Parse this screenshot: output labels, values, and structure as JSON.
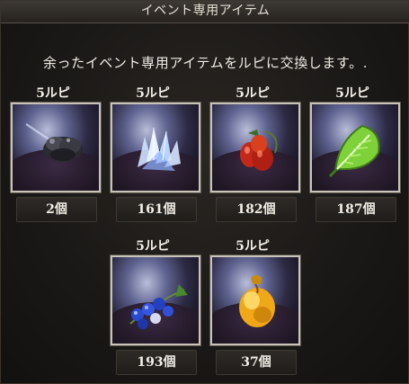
{
  "dialog": {
    "title": "イベント専用アイテム",
    "message": "余ったイベント専用アイテムをルピに交換します。."
  },
  "items": [
    {
      "price": "5ルピ",
      "count": "2個",
      "icon": "rock-icon"
    },
    {
      "price": "5ルピ",
      "count": "161個",
      "icon": "crystal-icon"
    },
    {
      "price": "5ルピ",
      "count": "182個",
      "icon": "berry-icon"
    },
    {
      "price": "5ルピ",
      "count": "187個",
      "icon": "leaf-icon"
    },
    {
      "price": "5ルピ",
      "count": "193個",
      "icon": "blueberry-icon"
    },
    {
      "price": "5ルピ",
      "count": "37個",
      "icon": "pouch-icon"
    }
  ],
  "colors": {
    "panel_bg": "#1b1917",
    "text": "#f0ece4",
    "frame_border": "#c9c4bb"
  }
}
